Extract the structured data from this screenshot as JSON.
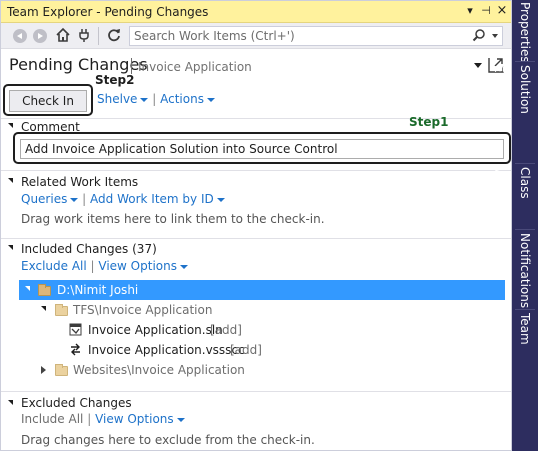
{
  "window": {
    "title": "Team Explorer - Pending Changes",
    "dropdown_glyph": "▾",
    "pin_glyph": "⊣",
    "close_glyph": "×"
  },
  "toolbar": {
    "search_placeholder": "Search Work Items (Ctrl+')"
  },
  "header": {
    "title": "Pending Changes",
    "subtitle": "Invoice Application"
  },
  "actions": {
    "checkin_label": "Check In",
    "shelve_label": "Shelve",
    "actions_label": "Actions",
    "step2_label": "Step2"
  },
  "comment": {
    "section_title": "Comment",
    "value": "Add Invoice Application Solution into Source Control",
    "step1_label": "Step1"
  },
  "related_work_items": {
    "section_title": "Related Work Items",
    "queries_label": "Queries",
    "add_work_item_label": "Add Work Item by ID",
    "hint": "Drag work items here to link them to the check-in."
  },
  "included_changes": {
    "section_title": "Included Changes (37)",
    "exclude_all_label": "Exclude All",
    "view_options_label": "View Options",
    "tree": [
      {
        "label": "D:\\Nimit Joshi",
        "level": 0,
        "type": "folder",
        "expanded": true,
        "selected": true
      },
      {
        "label": "TFS\\Invoice Application",
        "level": 1,
        "type": "folder",
        "expanded": true,
        "selected": false
      },
      {
        "label": "Invoice Application.sln",
        "status": "[add]",
        "level": 2,
        "type": "sln-file"
      },
      {
        "label": "Invoice Application.vssscc",
        "status": "[add]",
        "level": 2,
        "type": "vssscc-file"
      },
      {
        "label": "Websites\\Invoice Application",
        "level": 1,
        "type": "folder",
        "expanded": false,
        "selected": false
      }
    ]
  },
  "excluded_changes": {
    "section_title": "Excluded Changes",
    "include_all_label": "Include All",
    "view_options_label": "View Options",
    "hint": "Drag changes here to exclude from the check-in."
  },
  "side_tabs": [
    "Properties",
    "Solution Explorer",
    "Class View",
    "Notifications",
    "Team Explorer"
  ],
  "colors": {
    "title_bar": "#fff29d",
    "link": "#1e72c9",
    "selection": "#3399ff",
    "side_tab_bg": "#2d2d5f",
    "step1_text": "#1a6a2a"
  }
}
